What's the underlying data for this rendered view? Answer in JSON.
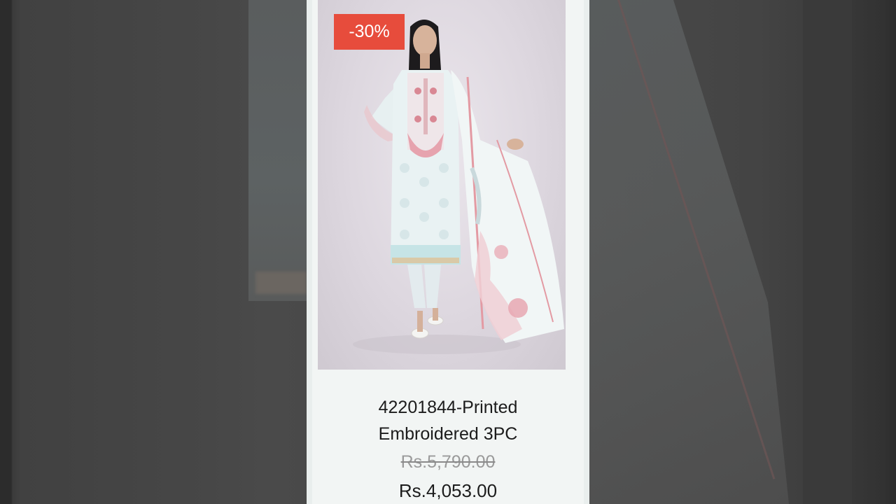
{
  "product": {
    "discount_badge": "-30%",
    "title_line1": "42201844-Printed",
    "title_line2": "Embroidered 3PC",
    "old_price": "Rs.5,790.00",
    "new_price": "Rs.4,053.00",
    "image_alt": "model-in-pastel-printed-embroidered-3pc-suit"
  },
  "colors": {
    "badge": "#e74c3c",
    "card_background": "#f2f5f4",
    "side_backdrop": "#444444"
  }
}
